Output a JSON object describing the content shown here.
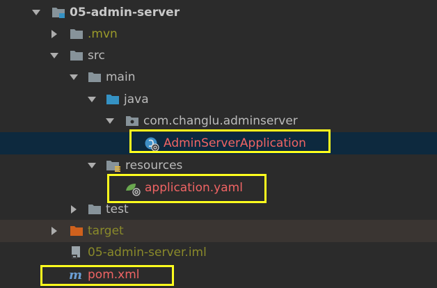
{
  "tree": {
    "root": {
      "label": "05-admin-server"
    },
    "mvn": {
      "label": ".mvn"
    },
    "src": {
      "label": "src"
    },
    "main": {
      "label": "main"
    },
    "java": {
      "label": "java"
    },
    "package": {
      "label": "com.changlu.adminserver"
    },
    "app_class": {
      "label": "AdminServerApplication"
    },
    "resources": {
      "label": "resources"
    },
    "app_yaml": {
      "label": "application.yaml"
    },
    "test": {
      "label": "test"
    },
    "target": {
      "label": "target"
    },
    "iml": {
      "label": "05-admin-server.iml"
    },
    "pom": {
      "label": "pom.xml"
    }
  },
  "colors": {
    "background": "#2b2b2b",
    "selected_row": "#0d293e",
    "excluded_row": "#3a3532",
    "highlight_box": "#ffff1e",
    "folder": "#87939a",
    "source_folder": "#3592c4",
    "resource_marker": "#e8b93e",
    "excluded_folder": "#d0611d",
    "modified_text": "#f06464",
    "ignored_text": "#9a9a2a"
  },
  "icons": {
    "expanded": "chevron-down-icon",
    "collapsed": "chevron-right-icon",
    "module": "module-folder-icon",
    "folder": "folder-icon",
    "source": "source-folder-icon",
    "package": "package-icon",
    "spring_class": "spring-boot-class-icon",
    "resources": "resources-folder-icon",
    "yaml": "spring-yaml-icon",
    "excluded": "excluded-folder-icon",
    "iml": "iml-file-icon",
    "maven": "maven-icon"
  }
}
